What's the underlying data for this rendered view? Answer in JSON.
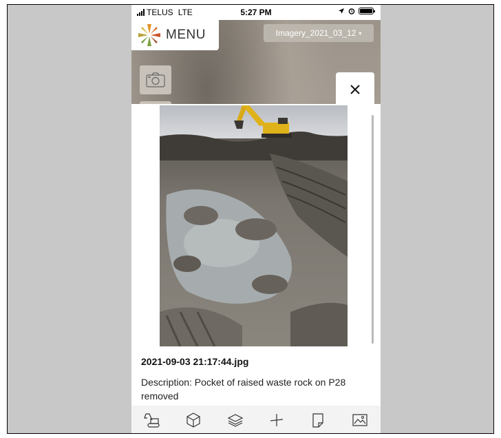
{
  "status_bar": {
    "carrier": "TELUS",
    "network": "LTE",
    "time": "5:27 PM"
  },
  "header": {
    "menu_label": "MENU",
    "imagery_select": {
      "value": "Imagery_2021_03_12",
      "caret": "▾"
    }
  },
  "map_tools": [
    {
      "icon": "camera-icon"
    }
  ],
  "photo_panel": {
    "close_icon": "close-icon",
    "filename": "2021-09-03 21:17:44.jpg",
    "description": "Description: Pocket of raised waste rock on P28 removed"
  },
  "bottom_toolbar": {
    "items": [
      {
        "icon": "excavator-icon"
      },
      {
        "icon": "cube-icon"
      },
      {
        "icon": "layers-icon"
      },
      {
        "icon": "measure-icon"
      },
      {
        "icon": "note-icon"
      },
      {
        "icon": "image-icon"
      }
    ]
  },
  "colors": {
    "panel_bg": "#ffffff",
    "toolbar_bg": "#f3f3f3",
    "select_bg": "#beb8b0",
    "excavator_yellow": "#e0b21a"
  }
}
